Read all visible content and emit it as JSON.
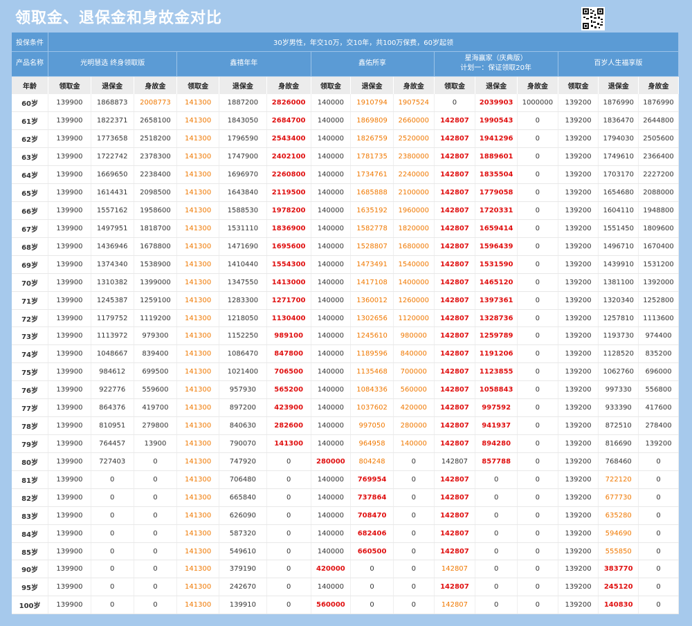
{
  "page": {
    "title": "领取金、退保金和身故金对比"
  },
  "header": {
    "condition_label": "投保条件",
    "condition_value": "30岁男性，年交10万，交10年，共100万保费，60岁起领",
    "product_label": "产品名称",
    "products": [
      {
        "name": "光明慧选 终身领取版",
        "name2": ""
      },
      {
        "name": "鑫禧年年",
        "name2": ""
      },
      {
        "name": "鑫佑所享",
        "name2": ""
      },
      {
        "name": "星海赢家（庆典版）",
        "name2": "计划一：保证领取20年"
      },
      {
        "name": "百岁人生福享版",
        "name2": ""
      }
    ],
    "sub": [
      "年龄",
      "领取金",
      "退保金",
      "身故金",
      "领取金",
      "退保金",
      "身故金",
      "领取金",
      "退保金",
      "身故金",
      "领取金",
      "退保金",
      "身故金",
      "领取金",
      "退保金",
      "身故金"
    ]
  },
  "colors": {
    "orange": "#f07800",
    "red": "#e01010",
    "header_blue": "#5b9bd5"
  },
  "rows": [
    {
      "v": [
        "60岁",
        "139900",
        "1868873",
        "2008773",
        "141300",
        "1887200",
        "2826000",
        "140000",
        "1910794",
        "1907524",
        "0",
        "2039903",
        "1000000",
        "139200",
        "1876990",
        "1876990"
      ],
      "c": "nnnoonrnoonrnnnn"
    },
    {
      "v": [
        "61岁",
        "139900",
        "1822371",
        "2658100",
        "141300",
        "1843050",
        "2684700",
        "140000",
        "1869809",
        "2660000",
        "142807",
        "1990543",
        "0",
        "139200",
        "1836470",
        "2644800"
      ],
      "c": "nnnnonrnoorrnnnn"
    },
    {
      "v": [
        "62岁",
        "139900",
        "1773658",
        "2518200",
        "141300",
        "1796590",
        "2543400",
        "140000",
        "1826759",
        "2520000",
        "142807",
        "1941296",
        "0",
        "139200",
        "1794030",
        "2505600"
      ],
      "c": "nnnnonrnoorrnnnn"
    },
    {
      "v": [
        "63岁",
        "139900",
        "1722742",
        "2378300",
        "141300",
        "1747900",
        "2402100",
        "140000",
        "1781735",
        "2380000",
        "142807",
        "1889601",
        "0",
        "139200",
        "1749610",
        "2366400"
      ],
      "c": "nnnnonrnoorrnnnn"
    },
    {
      "v": [
        "64岁",
        "139900",
        "1669650",
        "2238400",
        "141300",
        "1696970",
        "2260800",
        "140000",
        "1734761",
        "2240000",
        "142807",
        "1835504",
        "0",
        "139200",
        "1703170",
        "2227200"
      ],
      "c": "nnnnonrnoorrnnnn"
    },
    {
      "v": [
        "65岁",
        "139900",
        "1614431",
        "2098500",
        "141300",
        "1643840",
        "2119500",
        "140000",
        "1685888",
        "2100000",
        "142807",
        "1779058",
        "0",
        "139200",
        "1654680",
        "2088000"
      ],
      "c": "nnnnonrnoorrnnnn"
    },
    {
      "v": [
        "66岁",
        "139900",
        "1557162",
        "1958600",
        "141300",
        "1588530",
        "1978200",
        "140000",
        "1635192",
        "1960000",
        "142807",
        "1720331",
        "0",
        "139200",
        "1604110",
        "1948800"
      ],
      "c": "nnnnonrnoorrnnnn"
    },
    {
      "v": [
        "67岁",
        "139900",
        "1497951",
        "1818700",
        "141300",
        "1531110",
        "1836900",
        "140000",
        "1582778",
        "1820000",
        "142807",
        "1659414",
        "0",
        "139200",
        "1551450",
        "1809600"
      ],
      "c": "nnnnonrnoorrnnnn"
    },
    {
      "v": [
        "68岁",
        "139900",
        "1436946",
        "1678800",
        "141300",
        "1471690",
        "1695600",
        "140000",
        "1528807",
        "1680000",
        "142807",
        "1596439",
        "0",
        "139200",
        "1496710",
        "1670400"
      ],
      "c": "nnnnonrnoorrnnnn"
    },
    {
      "v": [
        "69岁",
        "139900",
        "1374340",
        "1538900",
        "141300",
        "1410440",
        "1554300",
        "140000",
        "1473491",
        "1540000",
        "142807",
        "1531590",
        "0",
        "139200",
        "1439910",
        "1531200"
      ],
      "c": "nnnnonrnoorrnnnn"
    },
    {
      "v": [
        "70岁",
        "139900",
        "1310382",
        "1399000",
        "141300",
        "1347550",
        "1413000",
        "140000",
        "1417108",
        "1400000",
        "142807",
        "1465120",
        "0",
        "139200",
        "1381100",
        "1392000"
      ],
      "c": "nnnnonrnoorrnnnn"
    },
    {
      "v": [
        "71岁",
        "139900",
        "1245387",
        "1259100",
        "141300",
        "1283300",
        "1271700",
        "140000",
        "1360012",
        "1260000",
        "142807",
        "1397361",
        "0",
        "139200",
        "1320340",
        "1252800"
      ],
      "c": "nnnnonrnoorrnnnn"
    },
    {
      "v": [
        "72岁",
        "139900",
        "1179752",
        "1119200",
        "141300",
        "1218050",
        "1130400",
        "140000",
        "1302656",
        "1120000",
        "142807",
        "1328736",
        "0",
        "139200",
        "1257810",
        "1113600"
      ],
      "c": "nnnnonrnoorrnnnn"
    },
    {
      "v": [
        "73岁",
        "139900",
        "1113972",
        "979300",
        "141300",
        "1152250",
        "989100",
        "140000",
        "1245610",
        "980000",
        "142807",
        "1259789",
        "0",
        "139200",
        "1193730",
        "974400"
      ],
      "c": "nnnnonrnoorrnnnn"
    },
    {
      "v": [
        "74岁",
        "139900",
        "1048667",
        "839400",
        "141300",
        "1086470",
        "847800",
        "140000",
        "1189596",
        "840000",
        "142807",
        "1191206",
        "0",
        "139200",
        "1128520",
        "835200"
      ],
      "c": "nnnnonrnoorrnnnn"
    },
    {
      "v": [
        "75岁",
        "139900",
        "984612",
        "699500",
        "141300",
        "1021400",
        "706500",
        "140000",
        "1135468",
        "700000",
        "142807",
        "1123855",
        "0",
        "139200",
        "1062760",
        "696000"
      ],
      "c": "nnnnonrnoorrnnnn"
    },
    {
      "v": [
        "76岁",
        "139900",
        "922776",
        "559600",
        "141300",
        "957930",
        "565200",
        "140000",
        "1084336",
        "560000",
        "142807",
        "1058843",
        "0",
        "139200",
        "997330",
        "556800"
      ],
      "c": "nnnnonrnoorrnnnn"
    },
    {
      "v": [
        "77岁",
        "139900",
        "864376",
        "419700",
        "141300",
        "897200",
        "423900",
        "140000",
        "1037602",
        "420000",
        "142807",
        "997592",
        "0",
        "139200",
        "933390",
        "417600"
      ],
      "c": "nnnnonrnoorrnnnn"
    },
    {
      "v": [
        "78岁",
        "139900",
        "810951",
        "279800",
        "141300",
        "840630",
        "282600",
        "140000",
        "997050",
        "280000",
        "142807",
        "941937",
        "0",
        "139200",
        "872510",
        "278400"
      ],
      "c": "nnnnonrnoorrnnnn"
    },
    {
      "v": [
        "79岁",
        "139900",
        "764457",
        "13900",
        "141300",
        "790070",
        "141300",
        "140000",
        "964958",
        "140000",
        "142807",
        "894280",
        "0",
        "139200",
        "816690",
        "139200"
      ],
      "c": "nnnnonrnoorrnnnn"
    },
    {
      "v": [
        "80岁",
        "139900",
        "727403",
        "0",
        "141300",
        "747920",
        "0",
        "280000",
        "804248",
        "0",
        "142807",
        "857788",
        "0",
        "139200",
        "768460",
        "0"
      ],
      "c": "nnnnonnronnrnnnn"
    },
    {
      "v": [
        "81岁",
        "139900",
        "0",
        "0",
        "141300",
        "706480",
        "0",
        "140000",
        "769954",
        "0",
        "142807",
        "0",
        "0",
        "139200",
        "722120",
        "0"
      ],
      "c": "nnnnonnnrnrnnnon"
    },
    {
      "v": [
        "82岁",
        "139900",
        "0",
        "0",
        "141300",
        "665840",
        "0",
        "140000",
        "737864",
        "0",
        "142807",
        "0",
        "0",
        "139200",
        "677730",
        "0"
      ],
      "c": "nnnnonnnrnrnnnon"
    },
    {
      "v": [
        "83岁",
        "139900",
        "0",
        "0",
        "141300",
        "626090",
        "0",
        "140000",
        "708470",
        "0",
        "142807",
        "0",
        "0",
        "139200",
        "635280",
        "0"
      ],
      "c": "nnnnonnnrnrnnnon"
    },
    {
      "v": [
        "84岁",
        "139900",
        "0",
        "0",
        "141300",
        "587320",
        "0",
        "140000",
        "682406",
        "0",
        "142807",
        "0",
        "0",
        "139200",
        "594690",
        "0"
      ],
      "c": "nnnnonnnrnrnnnon"
    },
    {
      "v": [
        "85岁",
        "139900",
        "0",
        "0",
        "141300",
        "549610",
        "0",
        "140000",
        "660500",
        "0",
        "142807",
        "0",
        "0",
        "139200",
        "555850",
        "0"
      ],
      "c": "nnnnonnnrnrnnnon"
    },
    {
      "v": [
        "90岁",
        "139900",
        "0",
        "0",
        "141300",
        "379190",
        "0",
        "420000",
        "0",
        "0",
        "142807",
        "0",
        "0",
        "139200",
        "383770",
        "0"
      ],
      "c": "nnnnonnrnnonnnrn"
    },
    {
      "v": [
        "95岁",
        "139900",
        "0",
        "0",
        "141300",
        "242670",
        "0",
        "140000",
        "0",
        "0",
        "142807",
        "0",
        "0",
        "139200",
        "245120",
        "0"
      ],
      "c": "nnnnonnnnnrnnnrn"
    },
    {
      "v": [
        "100岁",
        "139900",
        "0",
        "0",
        "141300",
        "139910",
        "0",
        "560000",
        "0",
        "0",
        "142807",
        "0",
        "0",
        "139200",
        "140830",
        "0"
      ],
      "c": "nnnnonnrnnonnnrn"
    }
  ]
}
